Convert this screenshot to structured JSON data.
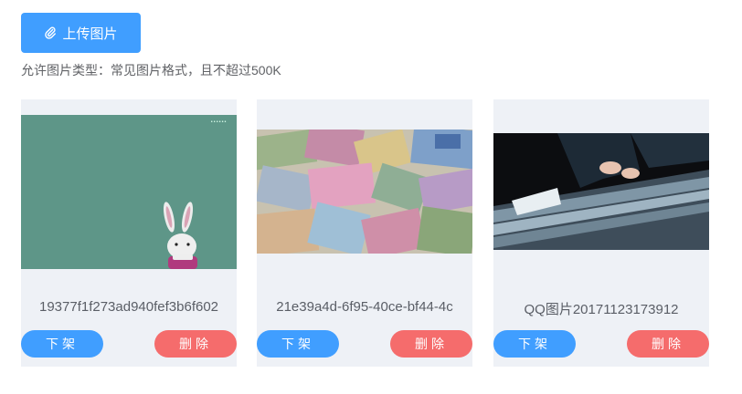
{
  "upload": {
    "label": "上传图片",
    "icon": "paperclip-icon"
  },
  "hint": "允许图片类型：常见图片格式，且不超过500K",
  "colors": {
    "primary": "#409eff",
    "danger": "#f56c6c",
    "card_bg": "#eef1f6"
  },
  "cards": [
    {
      "filename": "19377f1f273ad940fef3b6f602",
      "image": "rabbit-image",
      "take_down_label": "下架",
      "delete_label": "删除"
    },
    {
      "filename": "21e39a4d-6f95-40ce-bf44-4c",
      "image": "banknotes-puzzle-image",
      "take_down_label": "下架",
      "delete_label": "删除"
    },
    {
      "filename": "QQ图片20171123173912",
      "image": "file-drawer-image",
      "take_down_label": "下架",
      "delete_label": "删除"
    }
  ]
}
